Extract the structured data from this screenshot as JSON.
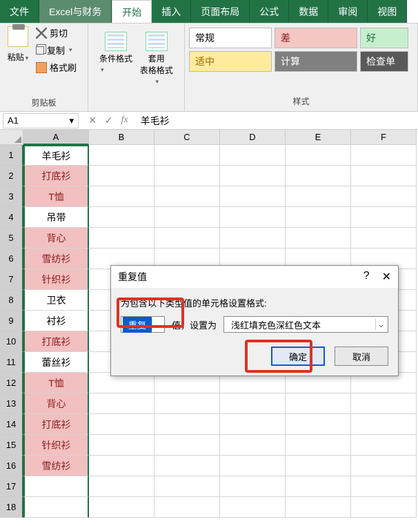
{
  "tabs": [
    "文件",
    "Excel与财务",
    "开始",
    "插入",
    "页面布局",
    "公式",
    "数据",
    "审阅",
    "视图"
  ],
  "active_tab": "开始",
  "ribbon": {
    "clipboard": {
      "paste": "粘贴",
      "cut": "剪切",
      "copy": "复制",
      "format_painter": "格式刷",
      "group_label": "剪贴板"
    },
    "cond_format": "条件格式",
    "table_format": "套用\n表格格式",
    "styles": {
      "normal": "常规",
      "bad": "差",
      "good": "好",
      "neutral": "适中",
      "calc": "计算",
      "check": "检查单",
      "group_label": "样式"
    }
  },
  "namebox": "A1",
  "formula_value": "羊毛衫",
  "columns": [
    "A",
    "B",
    "C",
    "D",
    "E",
    "F"
  ],
  "rows": [
    {
      "n": 1,
      "val": "羊毛衫",
      "dup": false
    },
    {
      "n": 2,
      "val": "打底衫",
      "dup": true
    },
    {
      "n": 3,
      "val": "T恤",
      "dup": true
    },
    {
      "n": 4,
      "val": "吊带",
      "dup": false
    },
    {
      "n": 5,
      "val": "背心",
      "dup": true
    },
    {
      "n": 6,
      "val": "雪纺衫",
      "dup": true
    },
    {
      "n": 7,
      "val": "针织衫",
      "dup": true
    },
    {
      "n": 8,
      "val": "卫衣",
      "dup": false
    },
    {
      "n": 9,
      "val": "衬衫",
      "dup": false
    },
    {
      "n": 10,
      "val": "打底衫",
      "dup": true
    },
    {
      "n": 11,
      "val": "蕾丝衫",
      "dup": false
    },
    {
      "n": 12,
      "val": "T恤",
      "dup": true
    },
    {
      "n": 13,
      "val": "背心",
      "dup": true
    },
    {
      "n": 14,
      "val": "打底衫",
      "dup": true
    },
    {
      "n": 15,
      "val": "针织衫",
      "dup": true
    },
    {
      "n": 16,
      "val": "雪纺衫",
      "dup": true
    },
    {
      "n": 17,
      "val": "",
      "dup": false
    },
    {
      "n": 18,
      "val": "",
      "dup": false
    }
  ],
  "dialog": {
    "title": "重复值",
    "prompt": "为包含以下类型值的单元格设置格式:",
    "type_value": "重复",
    "mid_text": "值，设置为",
    "format_value": "浅红填充色深红色文本",
    "ok": "确定",
    "cancel": "取消"
  }
}
